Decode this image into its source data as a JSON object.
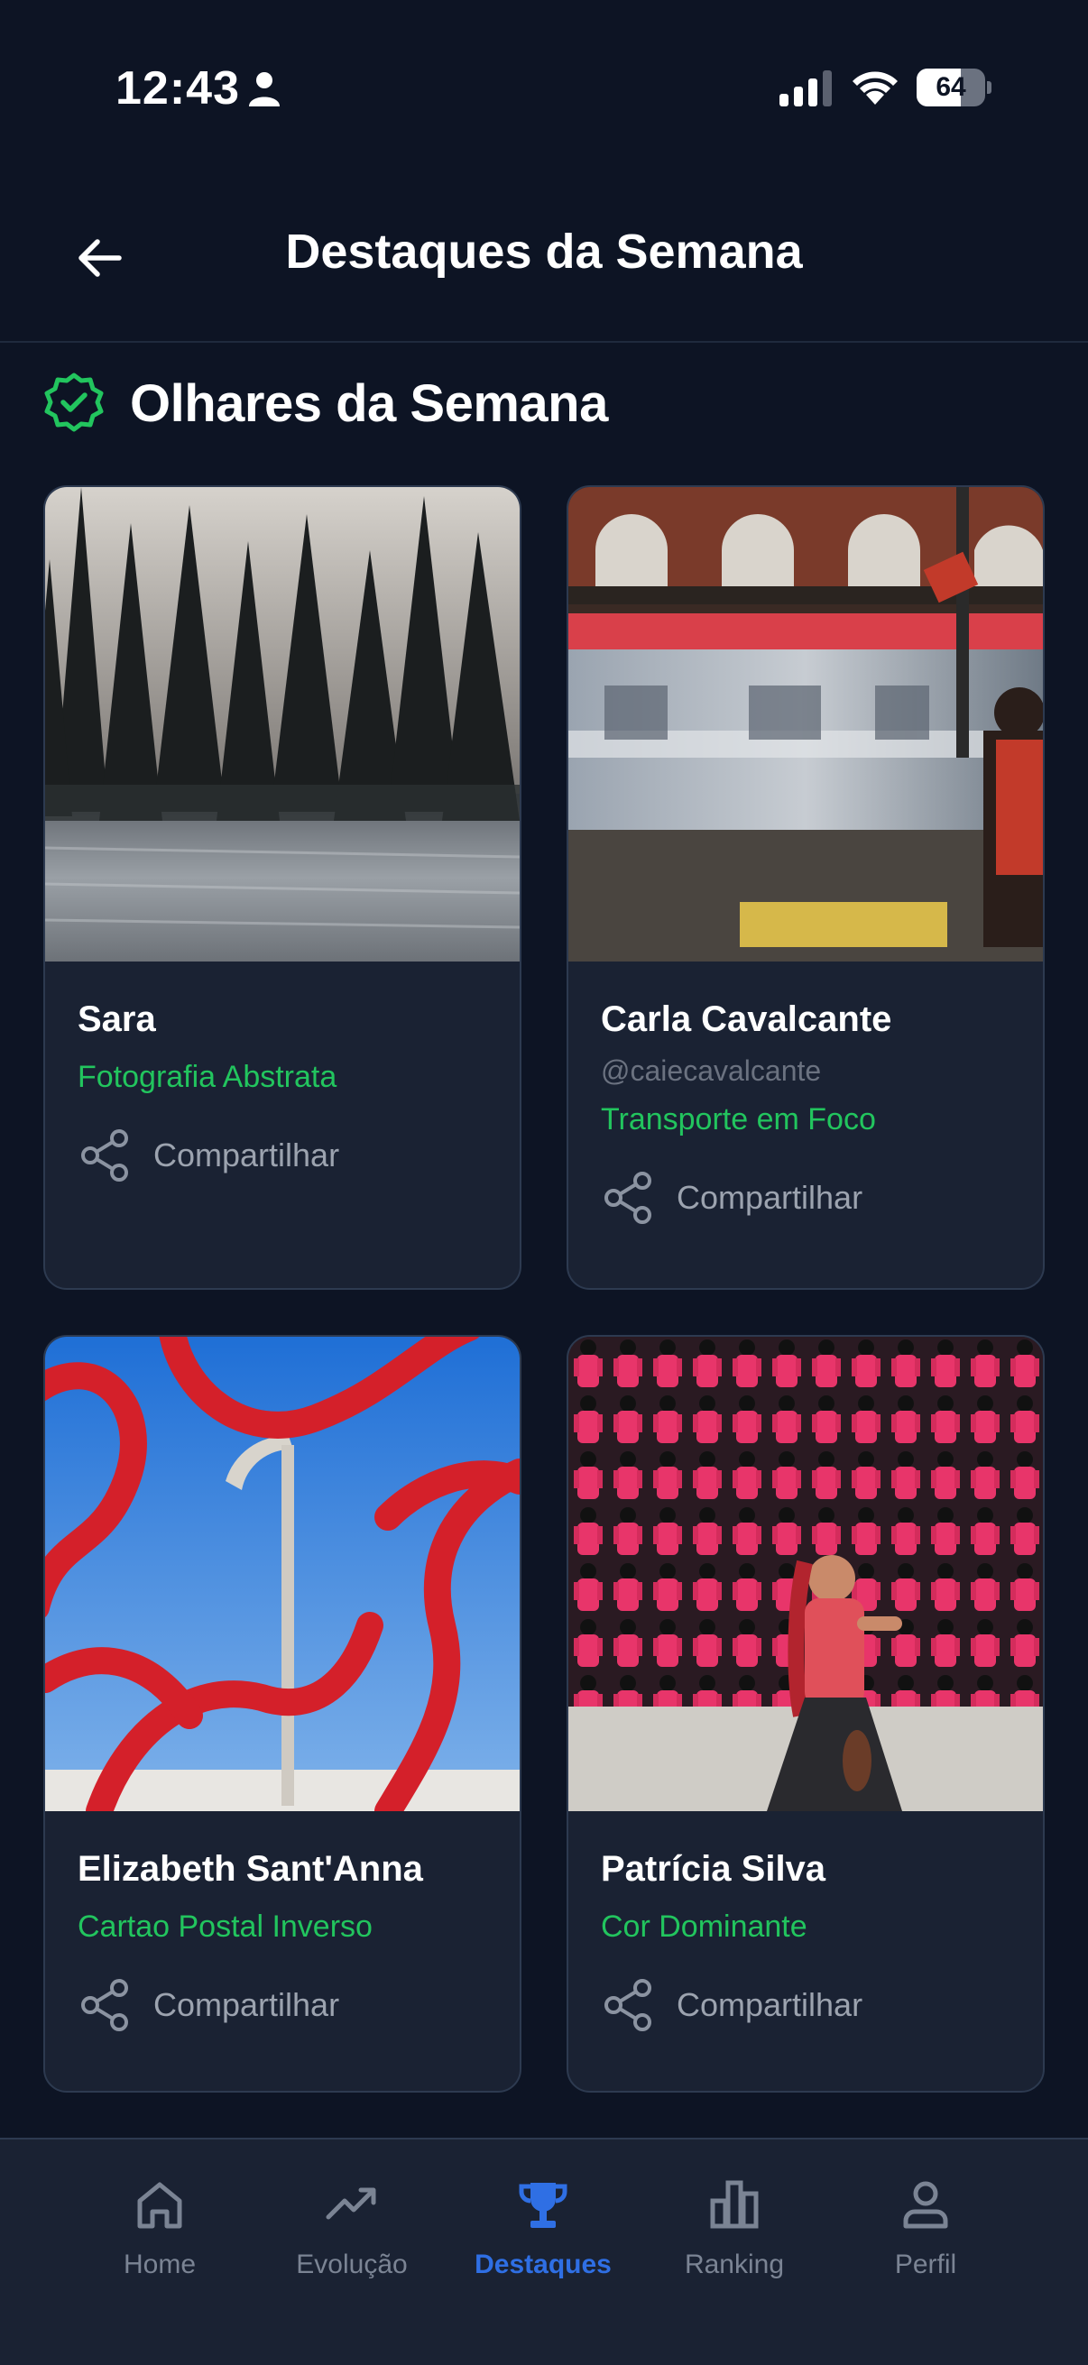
{
  "status_bar": {
    "time": "12:43",
    "battery_level": "64",
    "battery_fraction": 0.64,
    "icons": [
      "person-icon",
      "signal-icon",
      "wifi-icon",
      "battery-icon"
    ]
  },
  "header": {
    "title": "Destaques da Semana",
    "back_icon": "arrow-left-icon"
  },
  "section": {
    "title": "Olhares da Semana",
    "icon": "verified-badge-icon",
    "accent_color": "#22c55e"
  },
  "cards": [
    {
      "name": "Sara",
      "handle": "",
      "category": "Fotografia Abstrata",
      "share_label": "Compartilhar",
      "photo": "snowy-pine-forest-photo"
    },
    {
      "name": "Carla Cavalcante",
      "handle": "@caiecavalcante",
      "category": "Transporte em Foco",
      "share_label": "Compartilhar",
      "photo": "motion-blur-train-station-photo"
    },
    {
      "name": "Elizabeth Sant'Anna",
      "handle": "",
      "category": "Cartao Postal Inverso",
      "share_label": "Compartilhar",
      "photo": "red-sculpture-monument-photo"
    },
    {
      "name": "Patrícia Silva",
      "handle": "",
      "category": "Cor Dominante",
      "share_label": "Compartilhar",
      "photo": "red-figures-mural-photo"
    }
  ],
  "bottom_nav": {
    "items": [
      {
        "label": "Home",
        "icon": "home-icon"
      },
      {
        "label": "Evolução",
        "icon": "trending-up-icon"
      },
      {
        "label": "Destaques",
        "icon": "trophy-icon"
      },
      {
        "label": "Ranking",
        "icon": "bar-chart-icon"
      },
      {
        "label": "Perfil",
        "icon": "user-icon"
      }
    ],
    "active": "Destaques",
    "active_color": "#2f6fe4"
  }
}
